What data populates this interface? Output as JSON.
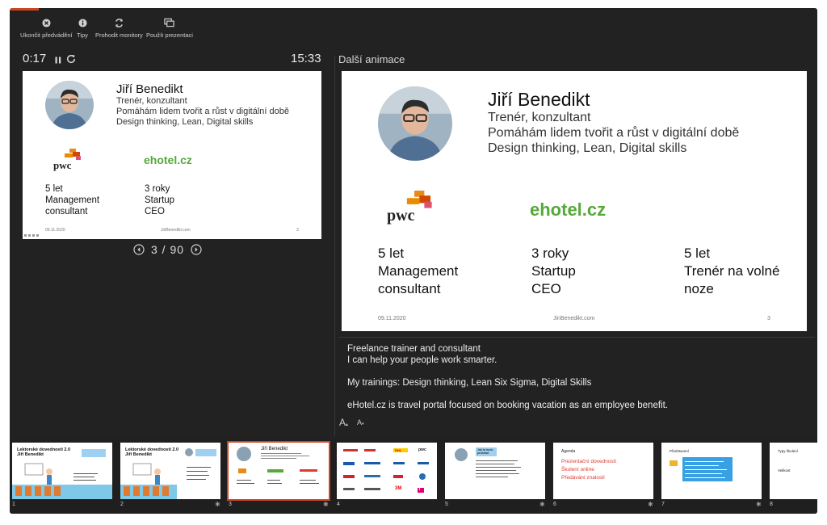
{
  "toolbar": {
    "end_label": "Ukončit předvádění",
    "tips_label": "Tipy",
    "swap_label": "Prohodit monitory",
    "use_label": "Použít prezentaci"
  },
  "presenter": {
    "elapsed": "0:17",
    "clock": "15:33",
    "page_indicator": "3 / 90",
    "next_label": "Další animace",
    "font_increase": "A",
    "font_decrease": "A"
  },
  "slide": {
    "name": "Jiří Benedikt",
    "line1": "Trenér, konzultant",
    "line2": "Pomáhám lidem tvořit a růst v digitální době",
    "line3": "Design thinking, Lean, Digital skills",
    "pwc": "pwc",
    "ehotel": "ehotel.cz",
    "stat1": [
      "5 let",
      "Management",
      "consultant"
    ],
    "stat2": [
      "3 roky",
      "Startup",
      "CEO"
    ],
    "stat3": [
      "5 let",
      "Trenér na volné",
      "noze"
    ],
    "date": "09.11.2020",
    "site": "JiriBenedikt.com",
    "num": "3"
  },
  "notes": [
    "Freelance trainer and consultant",
    "I can help your people work smarter.",
    "",
    "My trainings: Design thinking, Lean Six Sigma, Digital Skills",
    "",
    "eHotel.cz is travel portal focused on booking vacation as an employee benefit."
  ],
  "thumbnails": [
    {
      "num": "1",
      "title": "Lektorské dovednosti 2.0",
      "subtitle": "Jiří Benedikt",
      "has_star": false
    },
    {
      "num": "2",
      "title": "Lektorské dovednosti 2.0",
      "subtitle": "Jiří Benedikt",
      "has_star": true
    },
    {
      "num": "3",
      "title": "Jiří Benedikt",
      "has_star": true
    },
    {
      "num": "4",
      "logos": [
        "DHL",
        "pwc",
        "3M",
        "T"
      ],
      "has_star": false
    },
    {
      "num": "5",
      "callout": "Jak to bude probíhat",
      "has_star": true
    },
    {
      "num": "6",
      "title": "Agenda",
      "items": [
        "Prezentační dovednosti",
        "Školení online",
        "Předávání znalostí"
      ],
      "has_star": true
    },
    {
      "num": "7",
      "title": "Představení",
      "has_star": true
    },
    {
      "num": "8",
      "title": "Typy školení",
      "sub": "Velikost",
      "has_star": false
    }
  ],
  "colors": {
    "accent": "#d04423",
    "ehotel_green": "#57a83b",
    "agenda_red": "#e03a2f",
    "callout_blue": "#39a0e3"
  }
}
